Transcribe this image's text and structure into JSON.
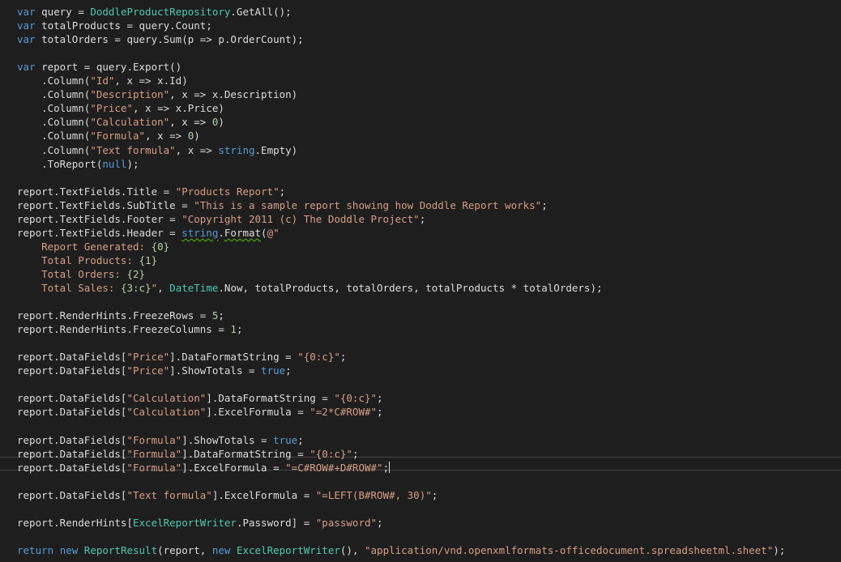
{
  "colors": {
    "background": "#1e1e1e",
    "plain": "#dcdcdc",
    "keyword": "#569cd6",
    "type": "#4ec9b0",
    "string": "#d69d85",
    "number": "#b5cea8",
    "current_line_border": "#464646",
    "squiggle": "#4e9a06"
  },
  "editor": {
    "current_line_index": 31,
    "lines": [
      [
        [
          "kw",
          "var"
        ],
        [
          "pl",
          " query = "
        ],
        [
          "ty",
          "DoddleProductRepository"
        ],
        [
          "pl",
          ".GetAll();"
        ]
      ],
      [
        [
          "kw",
          "var"
        ],
        [
          "pl",
          " totalProducts = query.Count;"
        ]
      ],
      [
        [
          "kw",
          "var"
        ],
        [
          "pl",
          " totalOrders = query.Sum(p => p.OrderCount);"
        ]
      ],
      [],
      [
        [
          "kw",
          "var"
        ],
        [
          "pl",
          " report = query.Export()"
        ]
      ],
      [
        [
          "pl",
          "    .Column("
        ],
        [
          "st",
          "\"Id\""
        ],
        [
          "pl",
          ", x => x.Id)"
        ]
      ],
      [
        [
          "pl",
          "    .Column("
        ],
        [
          "st",
          "\"Description\""
        ],
        [
          "pl",
          ", x => x.Description)"
        ]
      ],
      [
        [
          "pl",
          "    .Column("
        ],
        [
          "st",
          "\"Price\""
        ],
        [
          "pl",
          ", x => x.Price)"
        ]
      ],
      [
        [
          "pl",
          "    .Column("
        ],
        [
          "st",
          "\"Calculation\""
        ],
        [
          "pl",
          ", x => "
        ],
        [
          "nm",
          "0"
        ],
        [
          "pl",
          ")"
        ]
      ],
      [
        [
          "pl",
          "    .Column("
        ],
        [
          "st",
          "\"Formula\""
        ],
        [
          "pl",
          ", x => "
        ],
        [
          "nm",
          "0"
        ],
        [
          "pl",
          ")"
        ]
      ],
      [
        [
          "pl",
          "    .Column("
        ],
        [
          "st",
          "\"Text formula\""
        ],
        [
          "pl",
          ", x => "
        ],
        [
          "kw",
          "string"
        ],
        [
          "pl",
          ".Empty)"
        ]
      ],
      [
        [
          "pl",
          "    .ToReport("
        ],
        [
          "kw",
          "null"
        ],
        [
          "pl",
          ");"
        ]
      ],
      [],
      [
        [
          "pl",
          "report.TextFields.Title = "
        ],
        [
          "st",
          "\"Products Report\""
        ],
        [
          "pl",
          ";"
        ]
      ],
      [
        [
          "pl",
          "report.TextFields.SubTitle = "
        ],
        [
          "st",
          "\"This is a sample report showing how Doddle Report works\""
        ],
        [
          "pl",
          ";"
        ]
      ],
      [
        [
          "pl",
          "report.TextFields.Footer = "
        ],
        [
          "st",
          "\"Copyright 2011 (c) The Doddle Project\""
        ],
        [
          "pl",
          ";"
        ]
      ],
      [
        [
          "pl",
          "report.TextFields.Header = "
        ],
        [
          "kwsq",
          "string"
        ],
        [
          "pl",
          "."
        ],
        [
          "plsq",
          "Format"
        ],
        [
          "pl",
          "("
        ],
        [
          "st",
          "@\""
        ]
      ],
      [
        [
          "st",
          "    Report Generated: "
        ],
        [
          "nm",
          "{0}"
        ]
      ],
      [
        [
          "st",
          "    Total Products: "
        ],
        [
          "nm",
          "{1}"
        ]
      ],
      [
        [
          "st",
          "    Total Orders: "
        ],
        [
          "nm",
          "{2}"
        ]
      ],
      [
        [
          "st",
          "    Total Sales: "
        ],
        [
          "nm",
          "{3:c}"
        ],
        [
          "st",
          "\""
        ],
        [
          "pl",
          ", "
        ],
        [
          "ty",
          "DateTime"
        ],
        [
          "pl",
          ".Now, totalProducts, totalOrders, totalProducts * totalOrders);"
        ]
      ],
      [],
      [
        [
          "pl",
          "report.RenderHints.FreezeRows = "
        ],
        [
          "nm",
          "5"
        ],
        [
          "pl",
          ";"
        ]
      ],
      [
        [
          "pl",
          "report.RenderHints.FreezeColumns = "
        ],
        [
          "nm",
          "1"
        ],
        [
          "pl",
          ";"
        ]
      ],
      [],
      [
        [
          "pl",
          "report.DataFields["
        ],
        [
          "st",
          "\"Price\""
        ],
        [
          "pl",
          "].DataFormatString = "
        ],
        [
          "st",
          "\"{0:c}\""
        ],
        [
          "pl",
          ";"
        ]
      ],
      [
        [
          "pl",
          "report.DataFields["
        ],
        [
          "st",
          "\"Price\""
        ],
        [
          "pl",
          "].ShowTotals = "
        ],
        [
          "kw",
          "true"
        ],
        [
          "pl",
          ";"
        ]
      ],
      [],
      [
        [
          "pl",
          "report.DataFields["
        ],
        [
          "st",
          "\"Calculation\""
        ],
        [
          "pl",
          "].DataFormatString = "
        ],
        [
          "st",
          "\"{0:c}\""
        ],
        [
          "pl",
          ";"
        ]
      ],
      [
        [
          "pl",
          "report.DataFields["
        ],
        [
          "st",
          "\"Calculation\""
        ],
        [
          "pl",
          "].ExcelFormula = "
        ],
        [
          "st",
          "\"=2*C#ROW#\""
        ],
        [
          "pl",
          ";"
        ]
      ],
      [],
      [
        [
          "pl",
          "report.DataFields["
        ],
        [
          "st",
          "\"Formula\""
        ],
        [
          "pl",
          "].ShowTotals = "
        ],
        [
          "kw",
          "true"
        ],
        [
          "pl",
          ";"
        ]
      ],
      [
        [
          "pl",
          "report.DataFields["
        ],
        [
          "st",
          "\"Formula\""
        ],
        [
          "pl",
          "].DataFormatString = "
        ],
        [
          "st",
          "\"{0:c}\""
        ],
        [
          "pl",
          ";"
        ]
      ],
      [
        [
          "pl",
          "report.DataFields["
        ],
        [
          "st",
          "\"Formula\""
        ],
        [
          "pl",
          "].ExcelFormula = "
        ],
        [
          "st",
          "\"=C#ROW#+D#ROW#\""
        ],
        [
          "pl",
          ";"
        ],
        [
          "caret",
          ""
        ]
      ],
      [],
      [
        [
          "pl",
          "report.DataFields["
        ],
        [
          "st",
          "\"Text formula\""
        ],
        [
          "pl",
          "].ExcelFormula = "
        ],
        [
          "st",
          "\"=LEFT(B#ROW#, 30)\""
        ],
        [
          "pl",
          ";"
        ]
      ],
      [],
      [
        [
          "pl",
          "report.RenderHints["
        ],
        [
          "ty",
          "ExcelReportWriter"
        ],
        [
          "pl",
          ".Password] = "
        ],
        [
          "st",
          "\"password\""
        ],
        [
          "pl",
          ";"
        ]
      ],
      [],
      [
        [
          "kw",
          "return"
        ],
        [
          "pl",
          " "
        ],
        [
          "kw",
          "new"
        ],
        [
          "pl",
          " "
        ],
        [
          "ty",
          "ReportResult"
        ],
        [
          "pl",
          "(report, "
        ],
        [
          "kw",
          "new"
        ],
        [
          "pl",
          " "
        ],
        [
          "ty",
          "ExcelReportWriter"
        ],
        [
          "pl",
          "(), "
        ],
        [
          "st",
          "\"application/vnd.openxmlformats-officedocument.spreadsheetml.sheet\""
        ],
        [
          "pl",
          ");"
        ]
      ]
    ]
  }
}
